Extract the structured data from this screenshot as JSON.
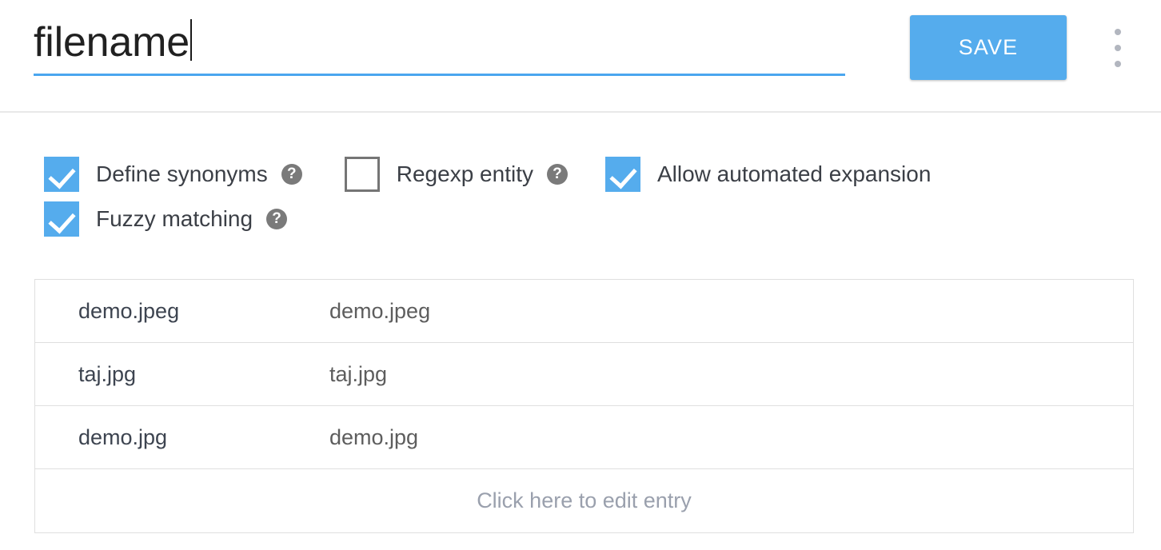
{
  "header": {
    "title_value": "filename",
    "title_placeholder": "Entity name",
    "save_label": "SAVE",
    "overflow_menu_icon": "more-vertical-icon",
    "accent_color": "#55aced",
    "underline_color": "#4aa6ef"
  },
  "options": {
    "help_icon_glyph": "?",
    "rows": [
      [
        {
          "label": "Define synonyms",
          "checked": true,
          "has_help": true
        },
        {
          "label": "Regexp entity",
          "checked": false,
          "has_help": true
        },
        {
          "label": "Allow automated expansion",
          "checked": true,
          "has_help": false
        }
      ],
      [
        {
          "label": "Fuzzy matching",
          "checked": true,
          "has_help": true
        }
      ]
    ]
  },
  "entries_table": {
    "rows": [
      {
        "value": "demo.jpeg",
        "synonyms": "demo.jpeg"
      },
      {
        "value": "taj.jpg",
        "synonyms": "taj.jpg"
      },
      {
        "value": "demo.jpg",
        "synonyms": "demo.jpg"
      }
    ],
    "placeholder_label": "Click here to edit entry"
  }
}
